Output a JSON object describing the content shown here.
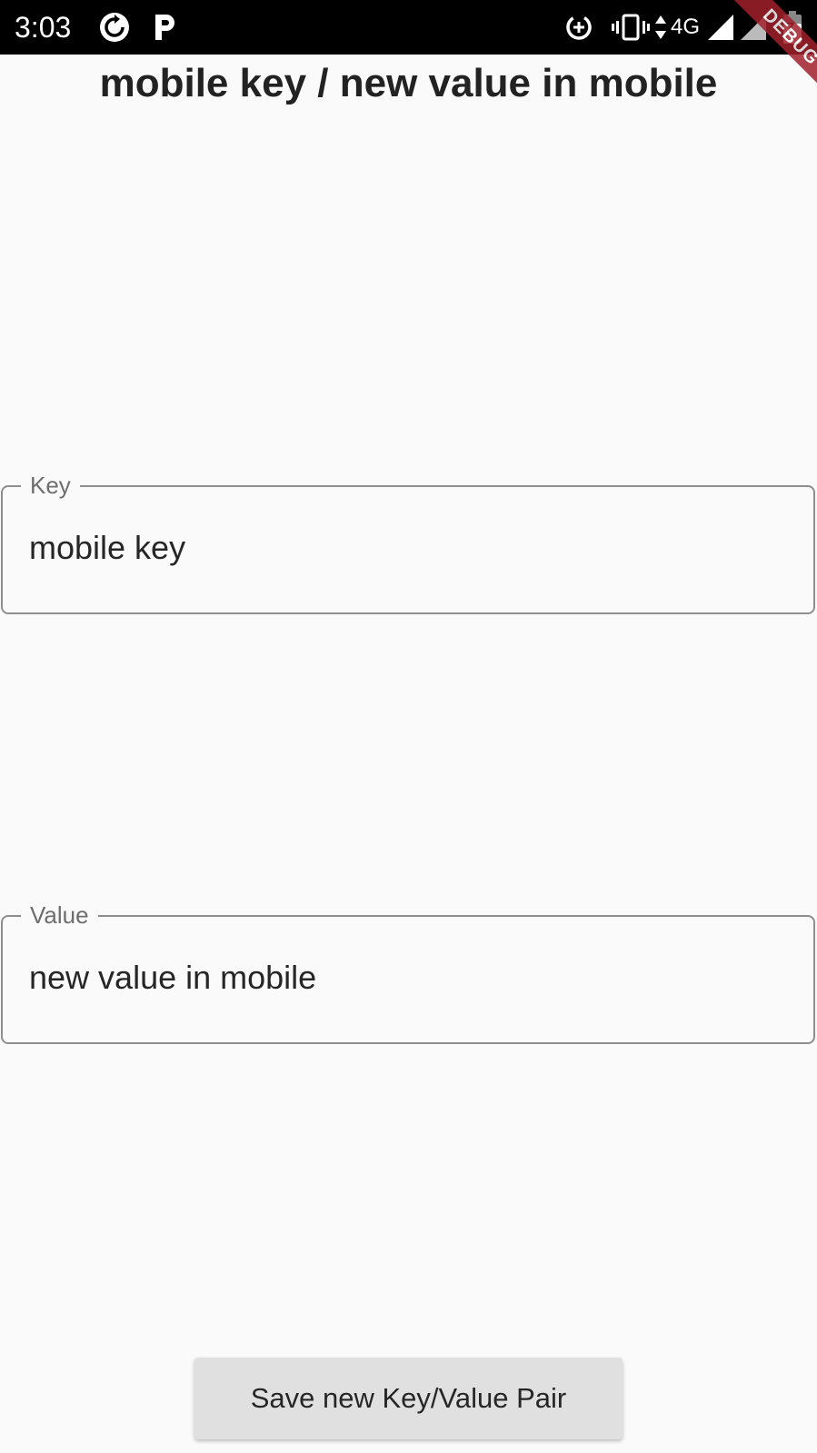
{
  "status_bar": {
    "time": "3:03",
    "network": "4G",
    "battery_level": "7",
    "icons": [
      "sync-icon",
      "p-icon",
      "data-saver-icon",
      "vibrate-icon",
      "data-arrows-icon",
      "signal-icon",
      "battery-icon"
    ]
  },
  "debug_banner": "DEBUG",
  "page": {
    "title": "mobile key / new value in mobile"
  },
  "form": {
    "key_field": {
      "label": "Key",
      "value": "mobile key"
    },
    "value_field": {
      "label": "Value",
      "value": "new value in mobile"
    },
    "save_label": "Save new Key/Value Pair"
  }
}
